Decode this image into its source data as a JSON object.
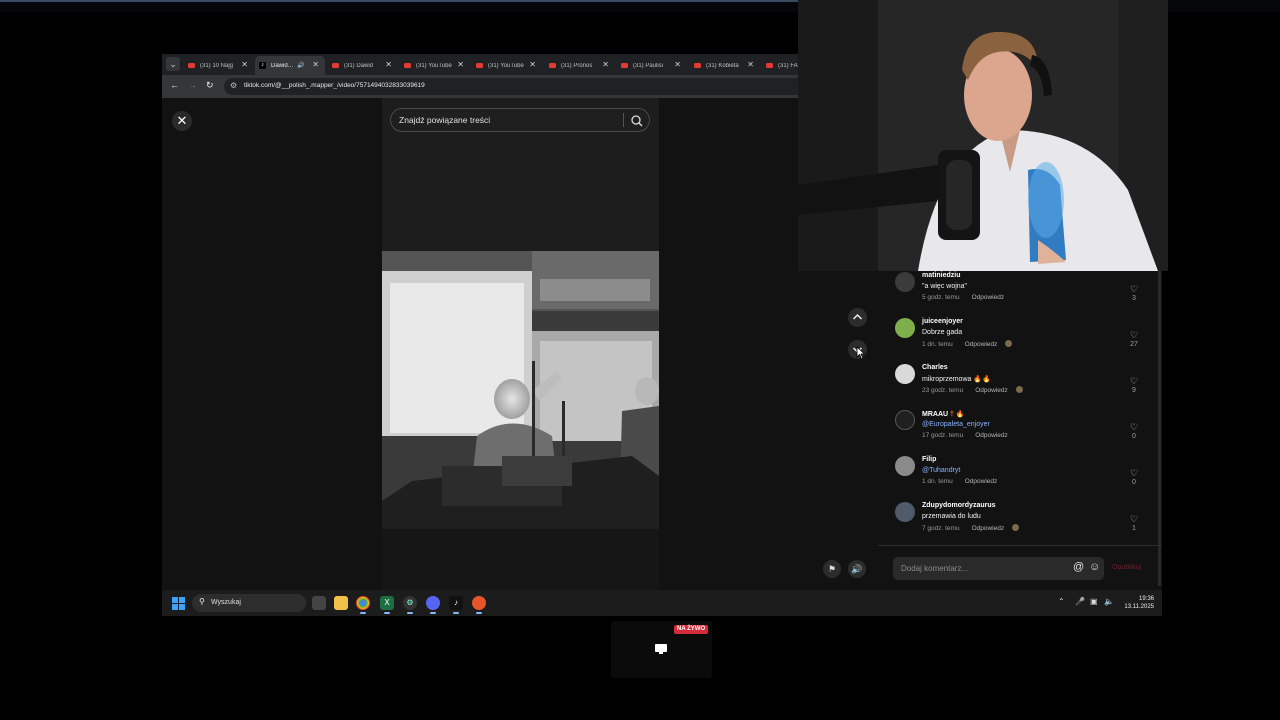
{
  "browser": {
    "tabs": [
      {
        "title": "(31) 10 Najg",
        "favicon": "youtube-icon"
      },
      {
        "title": "Dawid…",
        "favicon": "tiktok-icon",
        "active": true,
        "audio": true
      },
      {
        "title": "(31) Dawid ",
        "favicon": "youtube-icon"
      },
      {
        "title": "(31) YouTube",
        "favicon": "youtube-icon"
      },
      {
        "title": "(31) YouTube",
        "favicon": "youtube-icon"
      },
      {
        "title": "(31) Pronos",
        "favicon": "youtube-icon"
      },
      {
        "title": "(31) Paulisi",
        "favicon": "youtube-icon"
      },
      {
        "title": "(31) Kobieta",
        "favicon": "youtube-icon"
      },
      {
        "title": "(31) FA",
        "favicon": "youtube-icon"
      }
    ],
    "url": "tiktok.com/@__polish_.mapper_/video/7571494032833039619"
  },
  "tiktok": {
    "search_placeholder": "Znajdź powiązane treści",
    "comment_placeholder": "Dodaj komentarz...",
    "post_label": "Opublikuj",
    "reply_label": "Odpowiedz",
    "comments": [
      {
        "user": "matiniedziu",
        "text": "\"a więc wojna\"",
        "time": "5 godz. temu",
        "likes": "3",
        "reacted": false
      },
      {
        "user": "juiceenjoyer",
        "text": "Dobrze gada",
        "time": "1 dn. temu",
        "likes": "27",
        "reacted": true
      },
      {
        "user": "Charles",
        "text": "mikroprzemowa",
        "suffix": "🔥🔥",
        "time": "23 godz. temu",
        "likes": "9",
        "reacted": true
      },
      {
        "user": "MRAAU",
        "user_suffix": "† 🔥",
        "text": "@Europaleta_enjoyer",
        "mention": true,
        "time": "17 godz. temu",
        "likes": "0",
        "reacted": false
      },
      {
        "user": "Filip",
        "text": "@Tuhandryt",
        "mention": true,
        "time": "1 dn. temu",
        "likes": "0",
        "reacted": false
      },
      {
        "user": "Zdupydomordyzaurus",
        "text": "przemawia do ludu",
        "time": "7 godz. temu",
        "likes": "1",
        "reacted": true
      }
    ]
  },
  "taskbar": {
    "search_text": "Wyszukaj",
    "time": "19:36",
    "date": "13.11.2025"
  },
  "stream": {
    "live_label": "NA ŻYWO"
  },
  "colors": {
    "accent_red": "#d62c3a",
    "mention_blue": "#8ab4ff",
    "windows_blue": "#3aa3ff"
  }
}
